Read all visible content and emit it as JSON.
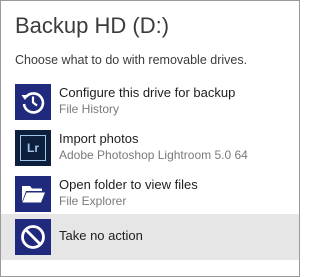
{
  "dialog": {
    "title": "Backup HD (D:)",
    "subtitle": "Choose what to do with removable drives."
  },
  "options": [
    {
      "label": "Configure this drive for backup",
      "sublabel": "File History",
      "icon": "file-history-icon"
    },
    {
      "label": "Import photos",
      "sublabel": "Adobe Photoshop Lightroom 5.0 64",
      "icon": "lightroom-icon",
      "icon_text": "Lr"
    },
    {
      "label": "Open folder to view files",
      "sublabel": "File Explorer",
      "icon": "folder-icon"
    },
    {
      "label": "Take no action",
      "icon": "no-action-icon",
      "selected": true
    }
  ],
  "colors": {
    "tile": "#1f2a7c",
    "lightroom_tile": "#0d1f3c",
    "lightroom_accent": "#9fc6ea",
    "selected_row": "#e6e6e6"
  }
}
